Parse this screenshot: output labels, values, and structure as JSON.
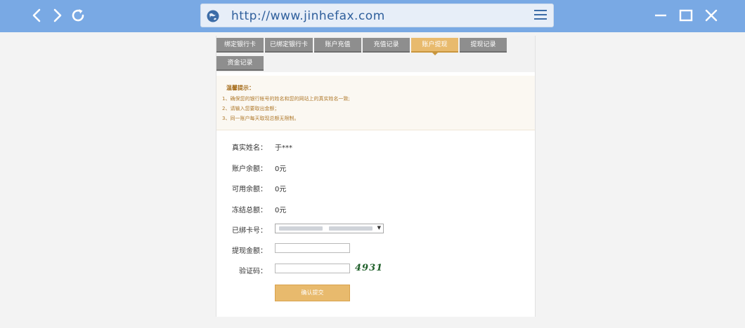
{
  "browser": {
    "url": "http://www.jinhefax.com"
  },
  "tabs": [
    {
      "label": "绑定银行卡"
    },
    {
      "label": "已绑定银行卡"
    },
    {
      "label": "账户充值"
    },
    {
      "label": "充值记录"
    },
    {
      "label": "账户提现",
      "active": true
    },
    {
      "label": "提现记录"
    },
    {
      "label": "资金记录"
    }
  ],
  "notice": {
    "title": "温馨提示：",
    "lines": [
      "1、确保您的银行帐号的姓名和您的网站上的真实姓名一致;",
      "2、请输入您要取出金额；",
      "3、同一账户每天取现总额无限制。"
    ]
  },
  "form": {
    "real_name_label": "真实姓名：",
    "real_name_value": "于***",
    "balance_label": "账户余额：",
    "balance_value": "0元",
    "available_label": "可用余额：",
    "available_value": "0元",
    "frozen_label": "冻结总额：",
    "frozen_value": "0元",
    "card_label": "已绑卡号：",
    "amount_label": "提现金额：",
    "captcha_label": "验证码：",
    "captcha_code": "4931",
    "submit_label": "确认提交"
  },
  "colors": {
    "topbar": "#79a9e4",
    "tab_default": "#8e8e8e",
    "tab_active": "#e8ba6d",
    "submit": "#e8ba6d"
  }
}
